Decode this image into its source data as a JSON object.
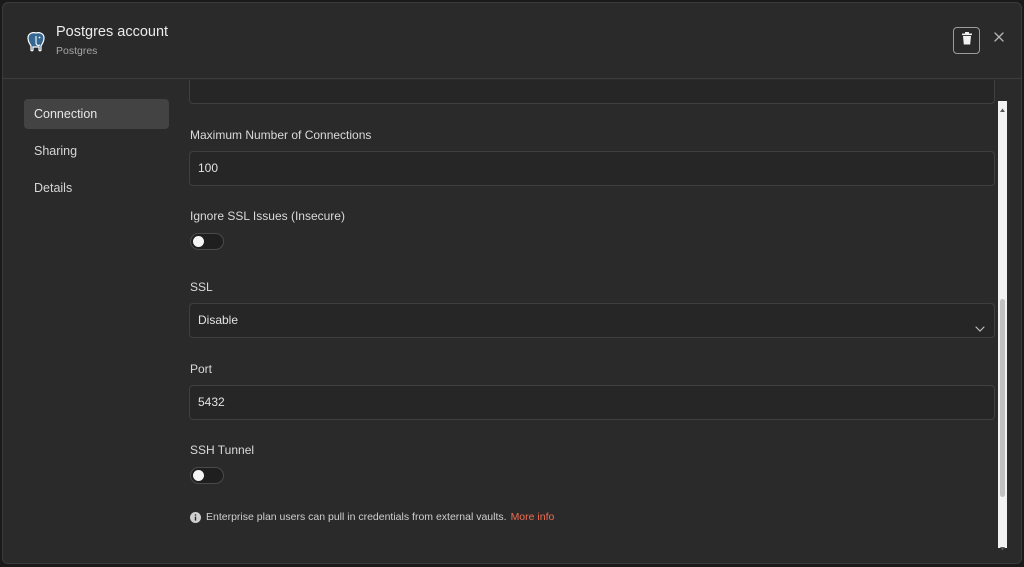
{
  "header": {
    "title": "Postgres account",
    "subtitle": "Postgres",
    "icon": "postgres-elephant-icon"
  },
  "sidebar": {
    "items": [
      {
        "label": "Connection",
        "active": true
      },
      {
        "label": "Sharing",
        "active": false
      },
      {
        "label": "Details",
        "active": false
      }
    ]
  },
  "form": {
    "max_connections": {
      "label": "Maximum Number of Connections",
      "value": "100"
    },
    "ignore_ssl": {
      "label": "Ignore SSL Issues (Insecure)",
      "enabled": false
    },
    "ssl": {
      "label": "SSL",
      "value": "Disable"
    },
    "port": {
      "label": "Port",
      "value": "5432"
    },
    "ssh_tunnel": {
      "label": "SSH Tunnel",
      "enabled": false
    }
  },
  "info": {
    "text": "Enterprise plan users can pull in credentials from external vaults.",
    "link": "More info"
  },
  "colors": {
    "accent_link": "#ef6e53",
    "modal_bg": "#2a2a2a",
    "input_bg": "#262626",
    "active_nav_bg": "#434343"
  }
}
